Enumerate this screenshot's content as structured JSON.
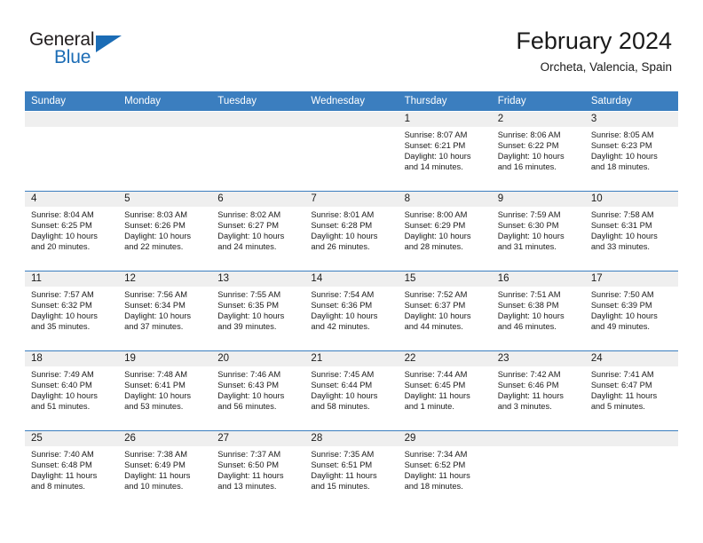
{
  "brand": {
    "name_top": "General",
    "name_bottom": "Blue",
    "color_primary": "#1b6cb5",
    "color_dark": "#231f20"
  },
  "header": {
    "title": "February 2024",
    "subtitle": "Orcheta, Valencia, Spain"
  },
  "theme": {
    "header_blue": "#3b7ebf",
    "day_band_gray": "#efefef",
    "text": "#1a1a1a"
  },
  "calendar": {
    "weekdays": [
      "Sunday",
      "Monday",
      "Tuesday",
      "Wednesday",
      "Thursday",
      "Friday",
      "Saturday"
    ],
    "weeks": [
      [
        {
          "day": "",
          "sunrise": "",
          "sunset": "",
          "daylight": "",
          "empty": true
        },
        {
          "day": "",
          "sunrise": "",
          "sunset": "",
          "daylight": "",
          "empty": true
        },
        {
          "day": "",
          "sunrise": "",
          "sunset": "",
          "daylight": "",
          "empty": true
        },
        {
          "day": "",
          "sunrise": "",
          "sunset": "",
          "daylight": "",
          "empty": true
        },
        {
          "day": "1",
          "sunrise": "Sunrise: 8:07 AM",
          "sunset": "Sunset: 6:21 PM",
          "daylight": "Daylight: 10 hours and 14 minutes."
        },
        {
          "day": "2",
          "sunrise": "Sunrise: 8:06 AM",
          "sunset": "Sunset: 6:22 PM",
          "daylight": "Daylight: 10 hours and 16 minutes."
        },
        {
          "day": "3",
          "sunrise": "Sunrise: 8:05 AM",
          "sunset": "Sunset: 6:23 PM",
          "daylight": "Daylight: 10 hours and 18 minutes."
        }
      ],
      [
        {
          "day": "4",
          "sunrise": "Sunrise: 8:04 AM",
          "sunset": "Sunset: 6:25 PM",
          "daylight": "Daylight: 10 hours and 20 minutes."
        },
        {
          "day": "5",
          "sunrise": "Sunrise: 8:03 AM",
          "sunset": "Sunset: 6:26 PM",
          "daylight": "Daylight: 10 hours and 22 minutes."
        },
        {
          "day": "6",
          "sunrise": "Sunrise: 8:02 AM",
          "sunset": "Sunset: 6:27 PM",
          "daylight": "Daylight: 10 hours and 24 minutes."
        },
        {
          "day": "7",
          "sunrise": "Sunrise: 8:01 AM",
          "sunset": "Sunset: 6:28 PM",
          "daylight": "Daylight: 10 hours and 26 minutes."
        },
        {
          "day": "8",
          "sunrise": "Sunrise: 8:00 AM",
          "sunset": "Sunset: 6:29 PM",
          "daylight": "Daylight: 10 hours and 28 minutes."
        },
        {
          "day": "9",
          "sunrise": "Sunrise: 7:59 AM",
          "sunset": "Sunset: 6:30 PM",
          "daylight": "Daylight: 10 hours and 31 minutes."
        },
        {
          "day": "10",
          "sunrise": "Sunrise: 7:58 AM",
          "sunset": "Sunset: 6:31 PM",
          "daylight": "Daylight: 10 hours and 33 minutes."
        }
      ],
      [
        {
          "day": "11",
          "sunrise": "Sunrise: 7:57 AM",
          "sunset": "Sunset: 6:32 PM",
          "daylight": "Daylight: 10 hours and 35 minutes."
        },
        {
          "day": "12",
          "sunrise": "Sunrise: 7:56 AM",
          "sunset": "Sunset: 6:34 PM",
          "daylight": "Daylight: 10 hours and 37 minutes."
        },
        {
          "day": "13",
          "sunrise": "Sunrise: 7:55 AM",
          "sunset": "Sunset: 6:35 PM",
          "daylight": "Daylight: 10 hours and 39 minutes."
        },
        {
          "day": "14",
          "sunrise": "Sunrise: 7:54 AM",
          "sunset": "Sunset: 6:36 PM",
          "daylight": "Daylight: 10 hours and 42 minutes."
        },
        {
          "day": "15",
          "sunrise": "Sunrise: 7:52 AM",
          "sunset": "Sunset: 6:37 PM",
          "daylight": "Daylight: 10 hours and 44 minutes."
        },
        {
          "day": "16",
          "sunrise": "Sunrise: 7:51 AM",
          "sunset": "Sunset: 6:38 PM",
          "daylight": "Daylight: 10 hours and 46 minutes."
        },
        {
          "day": "17",
          "sunrise": "Sunrise: 7:50 AM",
          "sunset": "Sunset: 6:39 PM",
          "daylight": "Daylight: 10 hours and 49 minutes."
        }
      ],
      [
        {
          "day": "18",
          "sunrise": "Sunrise: 7:49 AM",
          "sunset": "Sunset: 6:40 PM",
          "daylight": "Daylight: 10 hours and 51 minutes."
        },
        {
          "day": "19",
          "sunrise": "Sunrise: 7:48 AM",
          "sunset": "Sunset: 6:41 PM",
          "daylight": "Daylight: 10 hours and 53 minutes."
        },
        {
          "day": "20",
          "sunrise": "Sunrise: 7:46 AM",
          "sunset": "Sunset: 6:43 PM",
          "daylight": "Daylight: 10 hours and 56 minutes."
        },
        {
          "day": "21",
          "sunrise": "Sunrise: 7:45 AM",
          "sunset": "Sunset: 6:44 PM",
          "daylight": "Daylight: 10 hours and 58 minutes."
        },
        {
          "day": "22",
          "sunrise": "Sunrise: 7:44 AM",
          "sunset": "Sunset: 6:45 PM",
          "daylight": "Daylight: 11 hours and 1 minute."
        },
        {
          "day": "23",
          "sunrise": "Sunrise: 7:42 AM",
          "sunset": "Sunset: 6:46 PM",
          "daylight": "Daylight: 11 hours and 3 minutes."
        },
        {
          "day": "24",
          "sunrise": "Sunrise: 7:41 AM",
          "sunset": "Sunset: 6:47 PM",
          "daylight": "Daylight: 11 hours and 5 minutes."
        }
      ],
      [
        {
          "day": "25",
          "sunrise": "Sunrise: 7:40 AM",
          "sunset": "Sunset: 6:48 PM",
          "daylight": "Daylight: 11 hours and 8 minutes."
        },
        {
          "day": "26",
          "sunrise": "Sunrise: 7:38 AM",
          "sunset": "Sunset: 6:49 PM",
          "daylight": "Daylight: 11 hours and 10 minutes."
        },
        {
          "day": "27",
          "sunrise": "Sunrise: 7:37 AM",
          "sunset": "Sunset: 6:50 PM",
          "daylight": "Daylight: 11 hours and 13 minutes."
        },
        {
          "day": "28",
          "sunrise": "Sunrise: 7:35 AM",
          "sunset": "Sunset: 6:51 PM",
          "daylight": "Daylight: 11 hours and 15 minutes."
        },
        {
          "day": "29",
          "sunrise": "Sunrise: 7:34 AM",
          "sunset": "Sunset: 6:52 PM",
          "daylight": "Daylight: 11 hours and 18 minutes."
        },
        {
          "day": "",
          "sunrise": "",
          "sunset": "",
          "daylight": "",
          "empty": true
        },
        {
          "day": "",
          "sunrise": "",
          "sunset": "",
          "daylight": "",
          "empty": true
        }
      ]
    ]
  }
}
